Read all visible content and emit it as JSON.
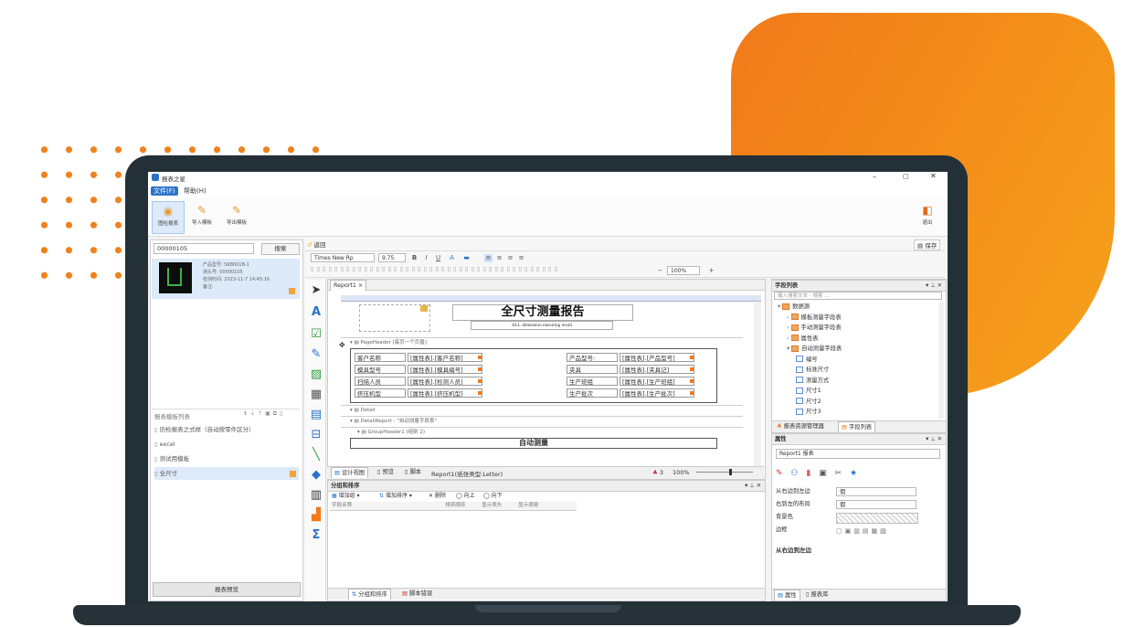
{
  "colors": {
    "accent": "#f07a1a",
    "app_blue": "#2b73c9",
    "laptop": "#243038"
  },
  "window": {
    "title": "报表之星"
  },
  "menu": {
    "file": "文件(F)",
    "help": "帮助(H)"
  },
  "ribbon": {
    "items": [
      {
        "label": "图检报表",
        "icon": "report-icon"
      },
      {
        "label": "导入模板",
        "icon": "import-icon"
      },
      {
        "label": "导出模板",
        "icon": "export-icon"
      }
    ],
    "exit_label": "退出"
  },
  "left": {
    "search_value": "00000105",
    "search_button": "搜索",
    "record": {
      "line1": "产品型号: SK8601B-1",
      "line2": "测头号: 00000105",
      "line3": "检测时间: 2023-11-7 14:45:16",
      "line4": "备注:"
    },
    "template_list_title": "报表模板列表",
    "templates": [
      "历检报表之式样（自动按零件区分）",
      "excel",
      "测试用模板",
      "全尺寸"
    ],
    "footer_button": "报表预览"
  },
  "designer": {
    "back_label": "返回",
    "save_label": "保存",
    "font_name": "Times New Rp",
    "font_size": "9.75",
    "zoom": "100%",
    "doc_tab": "Report1",
    "report_title": "全尺寸测量报告",
    "report_subtitle": "ALL dimension mesuring result",
    "band_page_header": "PageHeader [每页一个页眉]",
    "band_detail": "Detail",
    "band_detail_report": "DetailReport - \"自动测量字段表\"",
    "band_group_header": "GroupHeader1 (组别 2)",
    "band_next_title": "自动测量",
    "header_rows": [
      {
        "l1": "客户名称",
        "f1": "[属性表].[客户名称]",
        "l2": "产品型号:",
        "f2": "[属性表].[产品型号]"
      },
      {
        "l1": "模具型号",
        "f1": "[属性表].[模具编号]",
        "l2": "夹具",
        "f2": "[属性表].[夹具记]"
      },
      {
        "l1": "扫描人员",
        "f1": "[属性表].[检测人员]",
        "l2": "生产班组",
        "f2": "[属性表].[生产班组]"
      },
      {
        "l1": "挤压机型",
        "f1": "[属性表].[挤压机型]",
        "l2": "生产批次",
        "f2": "[属性表].[生产批次]"
      }
    ],
    "bottom_tabs": [
      "设计视图",
      "预览",
      "脚本"
    ],
    "status_text": "Report1(纸张类型:Letter)",
    "status_count": "3",
    "status_zoom": "100%"
  },
  "group_sort": {
    "title": "分组和排序",
    "add_group": "增加组",
    "add_sort": "增加排序",
    "delete": "删除",
    "up": "向上",
    "down": "向下",
    "columns": [
      "字段名称",
      "排序顺序",
      "显示表头",
      "显示表尾"
    ],
    "tabs": [
      "分组和排序",
      "脚本错误"
    ]
  },
  "field_list": {
    "title": "字段列表",
    "search_placeholder": "输入搜索文本 - 搜索 ...",
    "tree": [
      {
        "label": "数据源",
        "level": 0,
        "kind": "db"
      },
      {
        "label": "模板测量字段表",
        "level": 1,
        "kind": "table"
      },
      {
        "label": "手动测量字段表",
        "level": 1,
        "kind": "table"
      },
      {
        "label": "属性表",
        "level": 1,
        "kind": "table"
      },
      {
        "label": "自动测量字段表",
        "level": 1,
        "kind": "table"
      },
      {
        "label": "编号",
        "level": 2,
        "kind": "field"
      },
      {
        "label": "标准尺寸",
        "level": 2,
        "kind": "field"
      },
      {
        "label": "测量方式",
        "level": 2,
        "kind": "field"
      },
      {
        "label": "尺寸1",
        "level": 2,
        "kind": "field"
      },
      {
        "label": "尺寸2",
        "level": 2,
        "kind": "field"
      },
      {
        "label": "尺寸3",
        "level": 2,
        "kind": "field"
      }
    ],
    "tabs": [
      "报表资源管理器",
      "字段列表"
    ]
  },
  "properties": {
    "title": "属性",
    "selector": "Report1 报表",
    "rows": [
      {
        "label": "从右边到左边",
        "value": "假"
      },
      {
        "label": "右到左的布局",
        "value": "假"
      },
      {
        "label": "背景色",
        "value": ""
      },
      {
        "label": "边框",
        "value": ""
      }
    ],
    "description_title": "从右边到左边",
    "tabs": [
      "属性",
      "报表库"
    ]
  }
}
